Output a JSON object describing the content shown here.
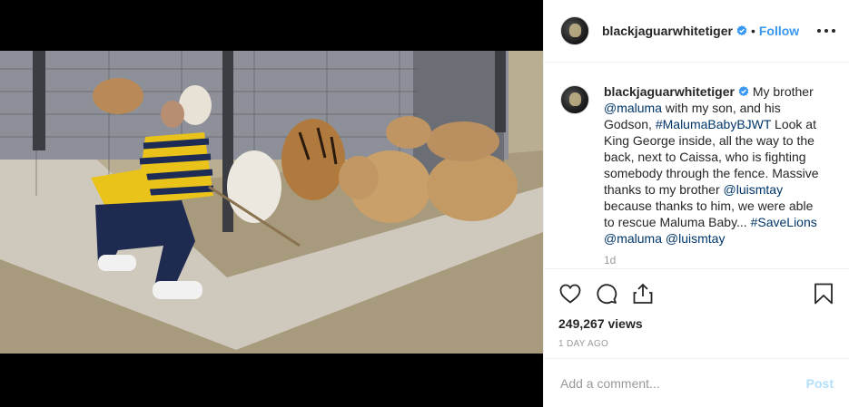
{
  "media": {
    "type": "video"
  },
  "header": {
    "username": "blackjaguarwhitetiger",
    "separator": "•",
    "follow_label": "Follow"
  },
  "caption": {
    "username": "blackjaguarwhitetiger",
    "parts": [
      {
        "text": " My brother ",
        "link": false
      },
      {
        "text": "@maluma",
        "link": true
      },
      {
        "text": " with my son, and his Godson, ",
        "link": false
      },
      {
        "text": "#MalumaBabyBJWT",
        "link": true
      },
      {
        "text": " Look at King George inside, all the way to the back, next to Caissa, who is fighting somebody through the fence. Massive thanks to my brother ",
        "link": false
      },
      {
        "text": "@luismtay",
        "link": true
      },
      {
        "text": " because thanks to him, we were able to rescue Maluma Baby... ",
        "link": false
      },
      {
        "text": "#SaveLions",
        "link": true
      },
      {
        "text": " ",
        "link": false
      },
      {
        "text": "@maluma",
        "link": true
      },
      {
        "text": " ",
        "link": false
      },
      {
        "text": "@luismtay",
        "link": true
      }
    ],
    "time": "1d"
  },
  "actions": {
    "icons": [
      "heart-icon",
      "comment-icon",
      "share-icon",
      "bookmark-icon"
    ],
    "views": "249,267 views",
    "posted": "1 DAY AGO"
  },
  "comment": {
    "placeholder": "Add a comment...",
    "post_label": "Post"
  },
  "colors": {
    "link": "#003569",
    "follow": "#3897f0",
    "post_disabled": "#b2dffc",
    "verified": "#3897f0"
  }
}
